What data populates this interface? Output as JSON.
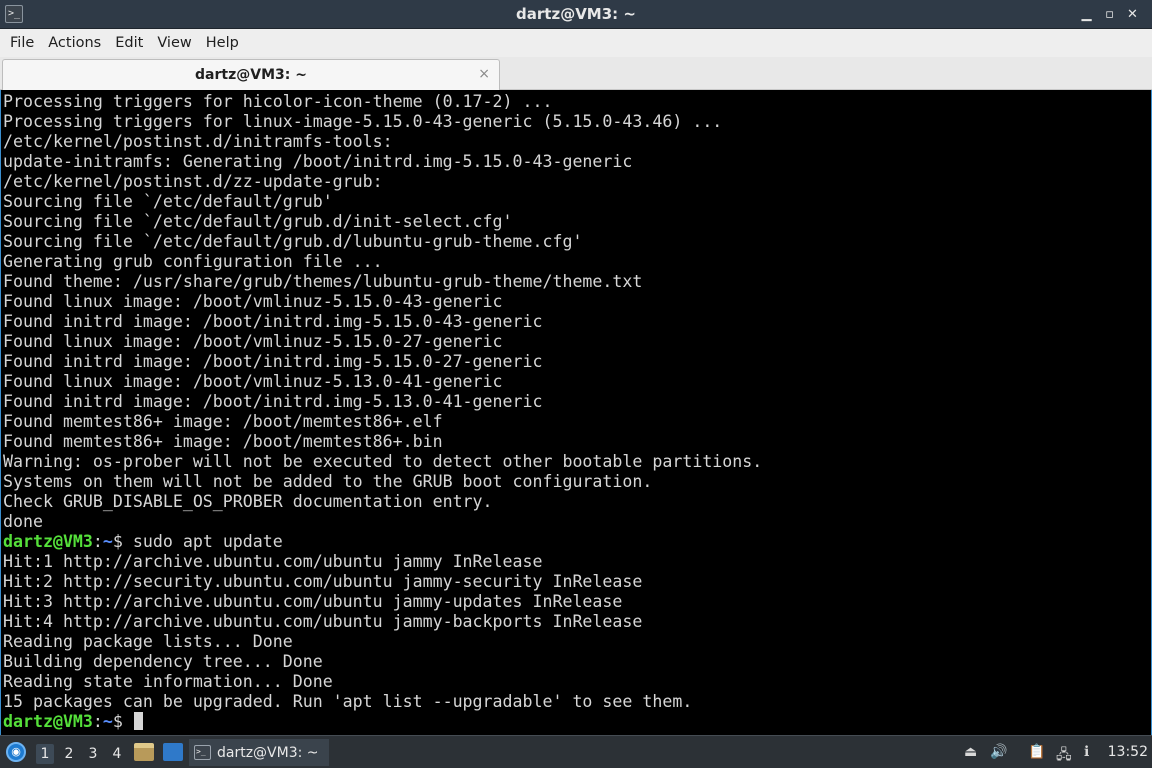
{
  "window": {
    "title": "dartz@VM3: ~",
    "icon": "terminal-icon",
    "controls": {
      "minimize": "▁",
      "maximize": "▫",
      "close": "✕"
    }
  },
  "menubar": {
    "items": [
      {
        "label": "File"
      },
      {
        "label": "Actions"
      },
      {
        "label": "Edit"
      },
      {
        "label": "View"
      },
      {
        "label": "Help"
      }
    ]
  },
  "tabs": [
    {
      "label": "dartz@VM3: ~",
      "close": "×"
    }
  ],
  "terminal": {
    "lines": [
      {
        "text": "Processing triggers for hicolor-icon-theme (0.17-2) ..."
      },
      {
        "text": "Processing triggers for linux-image-5.15.0-43-generic (5.15.0-43.46) ..."
      },
      {
        "text": "/etc/kernel/postinst.d/initramfs-tools:"
      },
      {
        "text": "update-initramfs: Generating /boot/initrd.img-5.15.0-43-generic"
      },
      {
        "text": "/etc/kernel/postinst.d/zz-update-grub:"
      },
      {
        "text": "Sourcing file `/etc/default/grub'"
      },
      {
        "text": "Sourcing file `/etc/default/grub.d/init-select.cfg'"
      },
      {
        "text": "Sourcing file `/etc/default/grub.d/lubuntu-grub-theme.cfg'"
      },
      {
        "text": "Generating grub configuration file ..."
      },
      {
        "text": "Found theme: /usr/share/grub/themes/lubuntu-grub-theme/theme.txt"
      },
      {
        "text": "Found linux image: /boot/vmlinuz-5.15.0-43-generic"
      },
      {
        "text": "Found initrd image: /boot/initrd.img-5.15.0-43-generic"
      },
      {
        "text": "Found linux image: /boot/vmlinuz-5.15.0-27-generic"
      },
      {
        "text": "Found initrd image: /boot/initrd.img-5.15.0-27-generic"
      },
      {
        "text": "Found linux image: /boot/vmlinuz-5.13.0-41-generic"
      },
      {
        "text": "Found initrd image: /boot/initrd.img-5.13.0-41-generic"
      },
      {
        "text": "Found memtest86+ image: /boot/memtest86+.elf"
      },
      {
        "text": "Found memtest86+ image: /boot/memtest86+.bin"
      },
      {
        "text": "Warning: os-prober will not be executed to detect other bootable partitions."
      },
      {
        "text": "Systems on them will not be added to the GRUB boot configuration."
      },
      {
        "text": "Check GRUB_DISABLE_OS_PROBER documentation entry."
      },
      {
        "text": "done"
      },
      {
        "prompt_user": "dartz@VM3",
        "prompt_sep": ":",
        "prompt_path": "~",
        "prompt_end": "$ ",
        "text": "sudo apt update"
      },
      {
        "text": "Hit:1 http://archive.ubuntu.com/ubuntu jammy InRelease"
      },
      {
        "text": "Hit:2 http://security.ubuntu.com/ubuntu jammy-security InRelease"
      },
      {
        "text": "Hit:3 http://archive.ubuntu.com/ubuntu jammy-updates InRelease"
      },
      {
        "text": "Hit:4 http://archive.ubuntu.com/ubuntu jammy-backports InRelease"
      },
      {
        "text": "Reading package lists... Done"
      },
      {
        "text": "Building dependency tree... Done"
      },
      {
        "text": "Reading state information... Done"
      },
      {
        "text": "15 packages can be upgraded. Run 'apt list --upgradable' to see them."
      },
      {
        "prompt_user": "dartz@VM3",
        "prompt_sep": ":",
        "prompt_path": "~",
        "prompt_end": "$ ",
        "text": "",
        "cursor": true
      }
    ],
    "colors": {
      "background": "#000000",
      "text": "#d6d6d6",
      "prompt_user": "#55e03a",
      "prompt_path": "#5a8fff"
    }
  },
  "taskbar": {
    "start_icon": "lubuntu-menu-icon",
    "desktops": [
      "1",
      "2",
      "3",
      "4"
    ],
    "active_desktop": "1",
    "quicklaunch": [
      {
        "icon": "file-manager-icon"
      },
      {
        "icon": "show-desktop-icon"
      }
    ],
    "task": {
      "label": "dartz@VM3: ~",
      "icon": "terminal-icon"
    },
    "tray": [
      {
        "icon": "eject-icon",
        "glyph": "⏏"
      },
      {
        "icon": "volume-icon",
        "glyph": "🔊"
      },
      {
        "icon": "clipboard-icon",
        "glyph": "📋"
      },
      {
        "icon": "network-icon",
        "glyph": "🖧"
      },
      {
        "icon": "update-notifier-icon",
        "glyph": "ℹ"
      }
    ],
    "clock": "13:52"
  }
}
